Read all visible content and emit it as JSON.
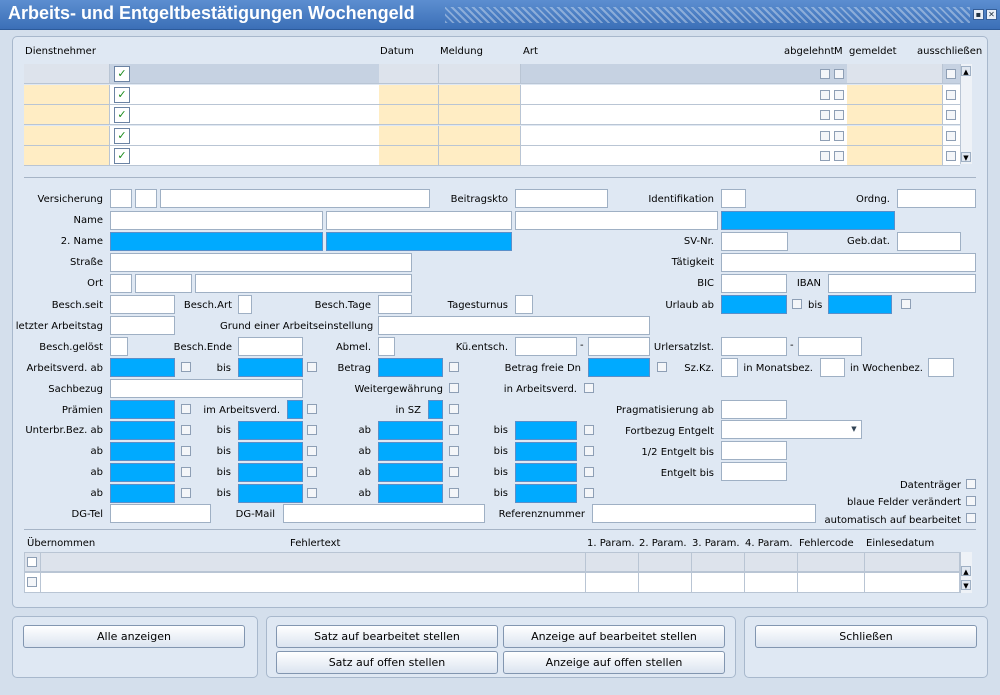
{
  "window": {
    "title": "Arbeits- und Entgeltbestätigungen Wochengeld"
  },
  "top_table": {
    "headers": {
      "dienstnehmer": "Dienstnehmer",
      "datum": "Datum",
      "meldung": "Meldung",
      "art": "Art",
      "abgelehnt": "abgelehnt",
      "m": "M",
      "gemeldet": "gemeldet",
      "ausschliessen": "ausschließen"
    },
    "rows": 5
  },
  "form": {
    "versicherung": "Versicherung",
    "beitragskto": "Beitragskto",
    "identifikation": "Identifikation",
    "ordng": "Ordng.",
    "name": "Name",
    "name2": "2. Name",
    "svnr": "SV-Nr.",
    "gebdat": "Geb.dat.",
    "strasse": "Straße",
    "taetigkeit": "Tätigkeit",
    "ort": "Ort",
    "bic": "BIC",
    "iban": "IBAN",
    "besch_seit": "Besch.seit",
    "besch_art": "Besch.Art",
    "besch_tage": "Besch.Tage",
    "tagesturnus": "Tagesturnus",
    "urlaub_ab": "Urlaub ab",
    "bis": "bis",
    "letzter_arbeitstag": "letzter Arbeitstag",
    "grund": "Grund einer Arbeitseinstellung",
    "besch_geloest": "Besch.gelöst",
    "besch_ende": "Besch.Ende",
    "abmel": "Abmel.",
    "kue_entsch": "Kü.entsch.",
    "urlersatzlst": "Urlersatzlst.",
    "dash": "-",
    "arbeitsverd_ab": "Arbeitsverd. ab",
    "betrag": "Betrag",
    "betrag_freie_dn": "Betrag freie Dn",
    "szkz": "Sz.Kz.",
    "in_monatsbez": "in Monatsbez.",
    "in_wochenbez": "in Wochenbez.",
    "sachbezug": "Sachbezug",
    "weitergewaehrung": "Weitergewährung",
    "in_arbeitsverd": "in Arbeitsverd.",
    "praemien": "Prämien",
    "im_arbeitsverd": "im Arbeitsverd.",
    "in_sz": "in SZ",
    "pragmatisierung_ab": "Pragmatisierung ab",
    "unterbr_bez_ab": "Unterbr.Bez. ab",
    "ab": "ab",
    "fortbezug_entgelt": "Fortbezug Entgelt",
    "halbe_entgelt_bis": "1/2 Entgelt bis",
    "entgelt_bis": "Entgelt bis",
    "datentraeger": "Datenträger",
    "blaue_felder": "blaue Felder verändert",
    "automatisch": "automatisch auf bearbeitet",
    "dg_tel": "DG-Tel",
    "dg_mail": "DG-Mail",
    "referenznummer": "Referenznummer"
  },
  "error_table": {
    "headers": {
      "uebernommen": "Übernommen",
      "fehlertext": "Fehlertext",
      "p1": "1. Param.",
      "p2": "2. Param.",
      "p3": "3. Param.",
      "p4": "4. Param.",
      "fehlercode": "Fehlercode",
      "einlesedatum": "Einlesedatum"
    }
  },
  "buttons": {
    "alle_anzeigen": "Alle anzeigen",
    "satz_bearbeitet": "Satz auf bearbeitet stellen",
    "anzeige_bearbeitet": "Anzeige auf bearbeitet stellen",
    "satz_offen": "Satz auf offen stellen",
    "anzeige_offen": "Anzeige auf offen stellen",
    "schliessen": "Schließen"
  },
  "colors": {
    "accent_blue": "#00aaff",
    "highlight_yellow": "#ffedc4",
    "title_bar": "#3b6fb7"
  }
}
